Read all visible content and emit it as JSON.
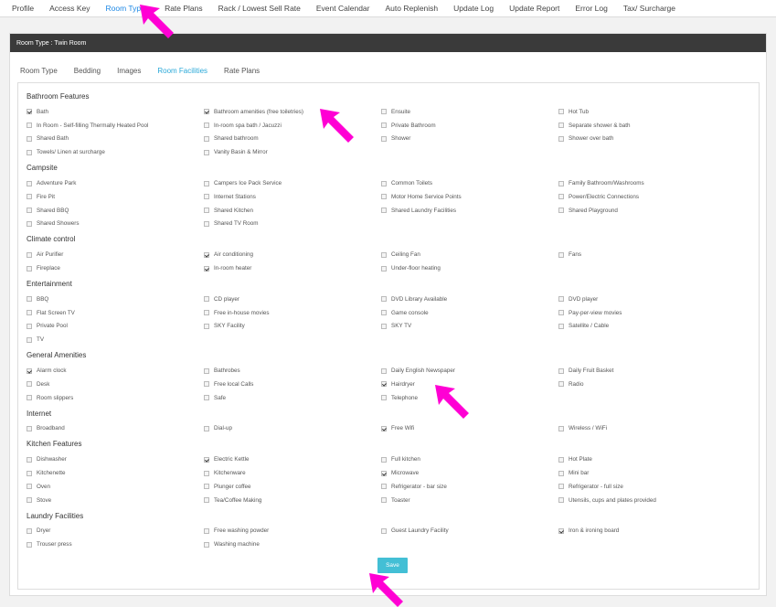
{
  "nav": [
    "Profile",
    "Access Key",
    "Room Types",
    "Rate Plans",
    "Rack / Lowest Sell Rate",
    "Event Calendar",
    "Auto Replenish",
    "Update Log",
    "Update Report",
    "Error Log",
    "Tax/ Surcharge"
  ],
  "nav_active": 2,
  "room_type_label": "Room Type : Twin Room",
  "subtabs": [
    "Room Type",
    "Bedding",
    "Images",
    "Room Facilities",
    "Rate Plans"
  ],
  "subtab_active": 3,
  "groups": [
    {
      "title": "Bathroom Features",
      "items": [
        {
          "label": "Bath",
          "checked": true
        },
        {
          "label": "Bathroom amenities (free toiletries)",
          "checked": true
        },
        {
          "label": "Ensuite",
          "checked": false
        },
        {
          "label": "Hot Tub",
          "checked": false
        },
        {
          "label": "In Room - Self-filling Thermally Heated Pool",
          "checked": false
        },
        {
          "label": "In-room spa bath / Jacuzzi",
          "checked": false
        },
        {
          "label": "Private Bathroom",
          "checked": false
        },
        {
          "label": "Separate shower & bath",
          "checked": false
        },
        {
          "label": "Shared Bath",
          "checked": false
        },
        {
          "label": "Shared bathroom",
          "checked": false
        },
        {
          "label": "Shower",
          "checked": false
        },
        {
          "label": "Shower over bath",
          "checked": false
        },
        {
          "label": "Towels/ Linen at surcharge",
          "checked": false
        },
        {
          "label": "Vanity Basin & Mirror",
          "checked": false
        }
      ]
    },
    {
      "title": "Campsite",
      "items": [
        {
          "label": "Adventure Park",
          "checked": false
        },
        {
          "label": "Campers Ice Pack Service",
          "checked": false
        },
        {
          "label": "Common Toilets",
          "checked": false
        },
        {
          "label": "Family Bathroom/Washrooms",
          "checked": false
        },
        {
          "label": "Fire Pit",
          "checked": false
        },
        {
          "label": "Internet Stations",
          "checked": false
        },
        {
          "label": "Motor Home Service Points",
          "checked": false
        },
        {
          "label": "Power/Electric Connections",
          "checked": false
        },
        {
          "label": "Shared BBQ",
          "checked": false
        },
        {
          "label": "Shared Kitchen",
          "checked": false
        },
        {
          "label": "Shared Laundry Facilities",
          "checked": false
        },
        {
          "label": "Shared Playground",
          "checked": false
        },
        {
          "label": "Shared Showers",
          "checked": false
        },
        {
          "label": "Shared TV Room",
          "checked": false
        }
      ]
    },
    {
      "title": "Climate control",
      "items": [
        {
          "label": "Air Purifier",
          "checked": false
        },
        {
          "label": "Air conditioning",
          "checked": true
        },
        {
          "label": "Ceiling Fan",
          "checked": false
        },
        {
          "label": "Fans",
          "checked": false
        },
        {
          "label": "Fireplace",
          "checked": false
        },
        {
          "label": "In-room heater",
          "checked": true
        },
        {
          "label": "Under-floor heating",
          "checked": false
        }
      ]
    },
    {
      "title": "Entertainment",
      "items": [
        {
          "label": "BBQ",
          "checked": false
        },
        {
          "label": "CD player",
          "checked": false
        },
        {
          "label": "DVD Library Available",
          "checked": false
        },
        {
          "label": "DVD player",
          "checked": false
        },
        {
          "label": "Flat Screen TV",
          "checked": false
        },
        {
          "label": "Free in-house movies",
          "checked": false
        },
        {
          "label": "Game console",
          "checked": false
        },
        {
          "label": "Pay-per-view movies",
          "checked": false
        },
        {
          "label": "Private Pool",
          "checked": false
        },
        {
          "label": "SKY Facility",
          "checked": false
        },
        {
          "label": "SKY TV",
          "checked": false
        },
        {
          "label": "Satellite / Cable",
          "checked": false
        },
        {
          "label": "TV",
          "checked": false
        }
      ]
    },
    {
      "title": "General Amenities",
      "items": [
        {
          "label": "Alarm clock",
          "checked": true
        },
        {
          "label": "Bathrobes",
          "checked": false
        },
        {
          "label": "Daily English Newspaper",
          "checked": false
        },
        {
          "label": "Daily Fruit Basket",
          "checked": false
        },
        {
          "label": "Desk",
          "checked": false
        },
        {
          "label": "Free local Calls",
          "checked": false
        },
        {
          "label": "Hairdryer",
          "checked": true
        },
        {
          "label": "Radio",
          "checked": false
        },
        {
          "label": "Room slippers",
          "checked": false
        },
        {
          "label": "Safe",
          "checked": false
        },
        {
          "label": "Telephone",
          "checked": false
        }
      ]
    },
    {
      "title": "Internet",
      "items": [
        {
          "label": "Broadband",
          "checked": false
        },
        {
          "label": "Dial-up",
          "checked": false
        },
        {
          "label": "Free Wifi",
          "checked": true
        },
        {
          "label": "Wireless / WiFi",
          "checked": false
        }
      ]
    },
    {
      "title": "Kitchen Features",
      "items": [
        {
          "label": "Dishwasher",
          "checked": false
        },
        {
          "label": "Electric Kettle",
          "checked": true
        },
        {
          "label": "Full kitchen",
          "checked": false
        },
        {
          "label": "Hot Plate",
          "checked": false
        },
        {
          "label": "Kitchenette",
          "checked": false
        },
        {
          "label": "Kitchenware",
          "checked": false
        },
        {
          "label": "Microwave",
          "checked": true
        },
        {
          "label": "Mini bar",
          "checked": false
        },
        {
          "label": "Oven",
          "checked": false
        },
        {
          "label": "Plunger coffee",
          "checked": false
        },
        {
          "label": "Refrigerator - bar size",
          "checked": false
        },
        {
          "label": "Refrigerator - full size",
          "checked": false
        },
        {
          "label": "Stove",
          "checked": false
        },
        {
          "label": "Tea/Coffee Making",
          "checked": false
        },
        {
          "label": "Toaster",
          "checked": false
        },
        {
          "label": "Utensils, cups and plates provided",
          "checked": false
        }
      ]
    },
    {
      "title": "Laundry Facilities",
      "items": [
        {
          "label": "Dryer",
          "checked": false
        },
        {
          "label": "Free washing powder",
          "checked": false
        },
        {
          "label": "Guest Laundry Facility",
          "checked": false
        },
        {
          "label": "Iron & ironing board",
          "checked": true
        },
        {
          "label": "Trouser press",
          "checked": false
        },
        {
          "label": "Washing machine",
          "checked": false
        }
      ]
    }
  ],
  "save_label": "Save",
  "colors": {
    "accent": "#29a8d8",
    "save": "#43bfd5",
    "arrow": "#ff00d4",
    "header": "#3a3a3a"
  }
}
